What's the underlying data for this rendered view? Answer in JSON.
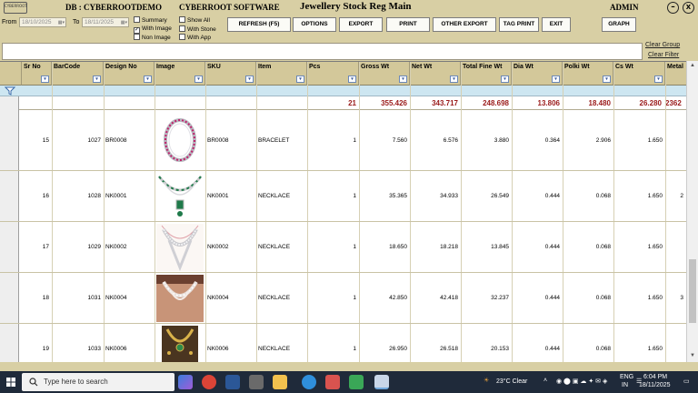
{
  "header": {
    "logo_text": "CYBERROOT",
    "db_label": "DB : CYBERROOTDEMO",
    "company": "CYBERROOT SOFTWARE",
    "title": "Jewellery Stock Reg Main",
    "user": "ADMIN",
    "minimize_glyph": "–",
    "close_glyph": "X"
  },
  "toolbar": {
    "from_label": "From",
    "from_date": "18/10/2025",
    "to_label": "To",
    "to_date": "18/11/2025",
    "checkboxes": {
      "summary": {
        "label": "Summary",
        "checked": false
      },
      "with_image": {
        "label": "With Image",
        "checked": true
      },
      "non_image": {
        "label": "Non Image",
        "checked": false
      },
      "show_all": {
        "label": "Show All",
        "checked": false
      },
      "with_stone": {
        "label": "With Stone",
        "checked": false
      },
      "with_app": {
        "label": "With App",
        "checked": false
      }
    },
    "buttons": {
      "refresh": "REFRESH (F5)",
      "options": "OPTIONS",
      "export": "EXPORT",
      "print": "PRINT",
      "other_export": "OTHER EXPORT",
      "tag_print": "TAG PRINT",
      "exit": "EXIT",
      "graph": "GRAPH"
    },
    "clear_group": "Clear Group",
    "clear_filter": "Clear Filter"
  },
  "grid": {
    "columns": [
      "Sr No",
      "BarCode",
      "Design No",
      "Image",
      "SKU",
      "Item",
      "Pcs",
      "Gross Wt",
      "Net Wt",
      "Total Fine Wt",
      "Dia Wt",
      "Polki Wt",
      "Cs Wt",
      "Metal"
    ],
    "totals": {
      "pcs": "21",
      "gross": "355.426",
      "net": "343.717",
      "fine": "248.698",
      "dia": "13.806",
      "polki": "18.480",
      "cs": "26.280",
      "metal": "2362"
    },
    "rows": [
      {
        "sr": "15",
        "barcode": "1027",
        "design": "BR0008",
        "sku": "BR0008",
        "item": "BRACELET",
        "pcs": "1",
        "gross": "7.560",
        "net": "6.576",
        "fine": "3.880",
        "dia": "0.364",
        "polki": "2.906",
        "cs": "1.650",
        "metal": ""
      },
      {
        "sr": "16",
        "barcode": "1028",
        "design": "NK0001",
        "sku": "NK0001",
        "item": "NECKLACE",
        "pcs": "1",
        "gross": "35.365",
        "net": "34.933",
        "fine": "26.549",
        "dia": "0.444",
        "polki": "0.068",
        "cs": "1.650",
        "metal": "2"
      },
      {
        "sr": "17",
        "barcode": "1029",
        "design": "NK0002",
        "sku": "NK0002",
        "item": "NECKLACE",
        "pcs": "1",
        "gross": "18.650",
        "net": "18.218",
        "fine": "13.845",
        "dia": "0.444",
        "polki": "0.068",
        "cs": "1.650",
        "metal": ""
      },
      {
        "sr": "18",
        "barcode": "1031",
        "design": "NK0004",
        "sku": "NK0004",
        "item": "NECKLACE",
        "pcs": "1",
        "gross": "42.850",
        "net": "42.418",
        "fine": "32.237",
        "dia": "0.444",
        "polki": "0.068",
        "cs": "1.650",
        "metal": "3"
      },
      {
        "sr": "19",
        "barcode": "1033",
        "design": "NK0006",
        "sku": "NK0006",
        "item": "NECKLACE",
        "pcs": "1",
        "gross": "26.950",
        "net": "26.518",
        "fine": "20.153",
        "dia": "0.444",
        "polki": "0.068",
        "cs": "1.650",
        "metal": ""
      }
    ]
  },
  "taskbar": {
    "search_placeholder": "Type here to search",
    "weather": "23°C  Clear",
    "lang_top": "ENG",
    "lang_bottom": "IN",
    "time": "6:04 PM",
    "date": "18/11/2025"
  },
  "colors": {
    "chrome": "#d8cfa4",
    "header": "#d3c89a",
    "filter_row": "#cde6f1",
    "totals_text": "#9a1a1a",
    "taskbar": "#1f2a3a"
  }
}
